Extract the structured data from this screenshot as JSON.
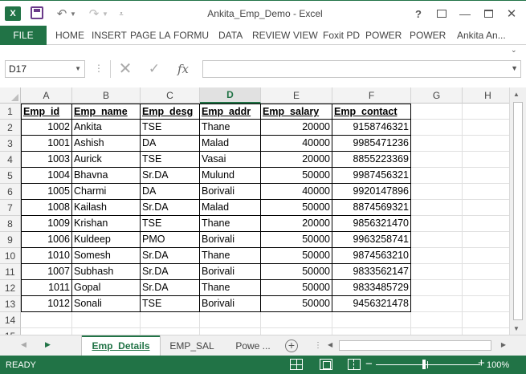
{
  "window": {
    "title": "Ankita_Emp_Demo - Excel",
    "help": "?",
    "user": "Ankita An..."
  },
  "ribbon": {
    "file_tab": "FILE",
    "tabs": [
      {
        "label": "HOME"
      },
      {
        "label": "INSERT"
      },
      {
        "label": "PAGE LA"
      },
      {
        "label": "FORMU"
      },
      {
        "label": "DATA"
      },
      {
        "label": "REVIEW"
      },
      {
        "label": "VIEW"
      },
      {
        "label": "Foxit PD"
      },
      {
        "label": "POWER"
      },
      {
        "label": "POWER"
      }
    ]
  },
  "formula_bar": {
    "name_box": "D17",
    "formula": ""
  },
  "grid": {
    "selected_column": "D",
    "columns": [
      "A",
      "B",
      "C",
      "D",
      "E",
      "F",
      "G",
      "H"
    ],
    "rows": [
      "1",
      "2",
      "3",
      "4",
      "5",
      "6",
      "7",
      "8",
      "9",
      "10",
      "11",
      "12",
      "13",
      "14",
      "15"
    ],
    "headers": [
      "Emp_id",
      "Emp_name",
      "Emp_desg",
      "Emp_addr",
      "Emp_salary",
      "Emp_contact"
    ],
    "records": [
      [
        "1002",
        "Ankita",
        "TSE",
        "Thane",
        "20000",
        "9158746321"
      ],
      [
        "1001",
        "Ashish",
        "DA",
        "Malad",
        "40000",
        "9985471236"
      ],
      [
        "1003",
        "Aurick",
        "TSE",
        "Vasai",
        "20000",
        "8855223369"
      ],
      [
        "1004",
        "Bhavna",
        "Sr.DA",
        "Mulund",
        "50000",
        "9987456321"
      ],
      [
        "1005",
        "Charmi",
        "DA",
        "Borivali",
        "40000",
        "9920147896"
      ],
      [
        "1008",
        "Kailash",
        "Sr.DA",
        "Malad",
        "50000",
        "8874569321"
      ],
      [
        "1009",
        "Krishan",
        "TSE",
        "Thane",
        "20000",
        "9856321470"
      ],
      [
        "1006",
        "Kuldeep",
        "PMO",
        "Borivali",
        "50000",
        "9963258741"
      ],
      [
        "1010",
        "Somesh",
        "Sr.DA",
        "Thane",
        "50000",
        "9874563210"
      ],
      [
        "1007",
        "Subhash",
        "Sr.DA",
        "Borivali",
        "50000",
        "9833562147"
      ],
      [
        "1011",
        "Gopal",
        "Sr.DA",
        "Thane",
        "50000",
        "9833485729"
      ],
      [
        "1012",
        "Sonali",
        "TSE",
        "Borivali",
        "50000",
        "9456321478"
      ]
    ]
  },
  "sheets": {
    "tabs": [
      {
        "label": "Emp_Details",
        "active": true
      },
      {
        "label": "EMP_SAL",
        "active": false
      },
      {
        "label": "Powe ...",
        "active": false
      }
    ]
  },
  "status": {
    "text": "READY",
    "zoom": "100%",
    "zoom_out": "−",
    "zoom_in": "+"
  },
  "colors": {
    "accent": "#217346"
  }
}
